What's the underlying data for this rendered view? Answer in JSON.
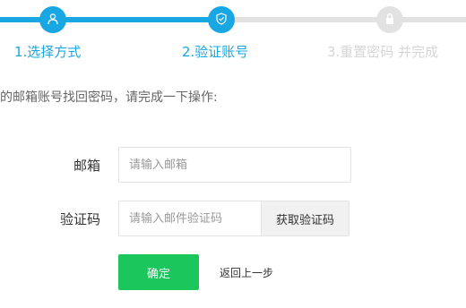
{
  "steps": [
    {
      "label": "1.选择方式",
      "icon": "user-icon",
      "state": "done"
    },
    {
      "label": "2.验证账号",
      "icon": "shield-icon",
      "state": "active"
    },
    {
      "label": "3.重置密码 并完成",
      "icon": "lock-icon",
      "state": "pending"
    }
  ],
  "intro": "的邮箱账号找回密码，请完成一下操作:",
  "form": {
    "email": {
      "label": "邮箱",
      "placeholder": "请输入邮箱"
    },
    "code": {
      "label": "验证码",
      "placeholder": "请输入邮件验证码"
    },
    "get_code_label": "获取验证码",
    "confirm_label": "确定",
    "back_label": "返回上一步"
  },
  "colors": {
    "accent": "#19a7e3",
    "inactive": "#e2e2e2",
    "confirm": "#1bc65c"
  }
}
